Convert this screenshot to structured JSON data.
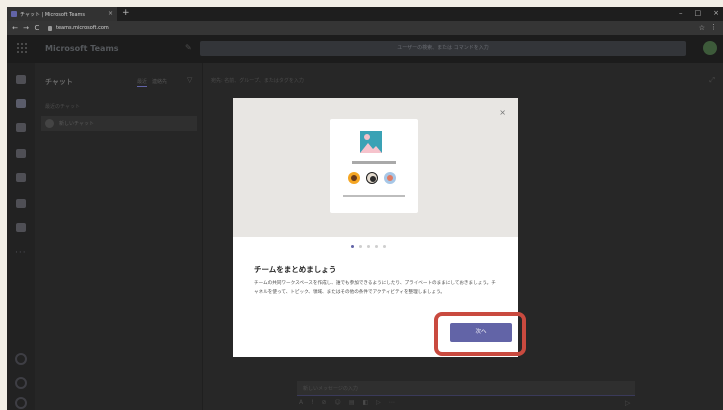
{
  "browser": {
    "tab_title": "チャット | Microsoft Teams",
    "tab_close": "×",
    "new_tab": "+",
    "url": "teams.microsoft.com",
    "window_controls": [
      "–",
      "□",
      "×"
    ],
    "nav": [
      "←",
      "→",
      "C"
    ]
  },
  "teams": {
    "brand": "Microsoft Teams",
    "search_placeholder": "ユーザーの検索、または コマンドを入力",
    "compose_icon": "✎"
  },
  "chat_panel": {
    "title": "チャット",
    "filter_recent": "最近",
    "filter_contacts": "連絡先",
    "recent_label": "最近のチャット",
    "item_label": "新しいチャット"
  },
  "main": {
    "to_line": "宛先: 名前、グループ、またはタグを入力",
    "composer_placeholder": "新しいメッセージの入力",
    "tool_icons": [
      "A",
      "!",
      "⊘",
      "☺",
      "▤",
      "◧",
      "▷",
      "⋯"
    ],
    "send_icon": "▷"
  },
  "dialog": {
    "close": "×",
    "title": "チームをまとめましょう",
    "body": "チームの共同ワークスペースを作成し、誰でも参加できるようにしたり、プライベートのままにしておきましょう。チャネルを使って、トピック、領域、またはその他の条件でアクティビティを整理しましょう。",
    "next_label": "次へ",
    "page_count": 5,
    "active_page": 1
  },
  "colors": {
    "accent": "#6264a7",
    "highlight": "#c94a3f"
  }
}
